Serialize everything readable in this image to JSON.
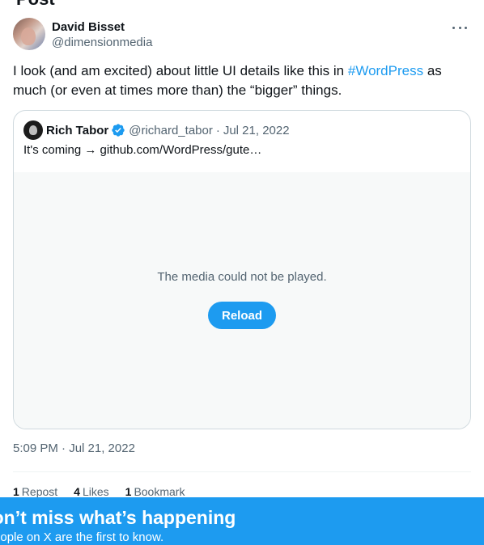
{
  "page": {
    "top_cut_title": "Post"
  },
  "author": {
    "name": "David Bisset",
    "handle": "@dimensionmedia"
  },
  "post": {
    "text_before": "I look (and am excited) about little UI details like this in ",
    "hashtag": "#WordPress",
    "text_after": " as much (or even at times more than) the “bigger” things.",
    "timestamp": "5:09 PM · Jul 21, 2022"
  },
  "quote": {
    "name": "Rich Tabor",
    "handle": "@richard_tabor",
    "separator": "·",
    "date": "Jul 21, 2022",
    "text": "It's coming → github.com/WordPress/gute…",
    "media_message": "The media could not be played.",
    "reload_label": "Reload"
  },
  "stats": {
    "reposts_count": "1",
    "reposts_label": "Repost",
    "likes_count": "4",
    "likes_label": "Likes",
    "bookmarks_count": "1",
    "bookmarks_label": "Bookmark"
  },
  "banner": {
    "title": "Don’t miss what’s happening",
    "subtitle": "People on X are the first to know."
  },
  "colors": {
    "accent": "#1d9bf0",
    "text_primary": "#0f1419",
    "text_secondary": "#536471",
    "border": "#cfd9de"
  }
}
